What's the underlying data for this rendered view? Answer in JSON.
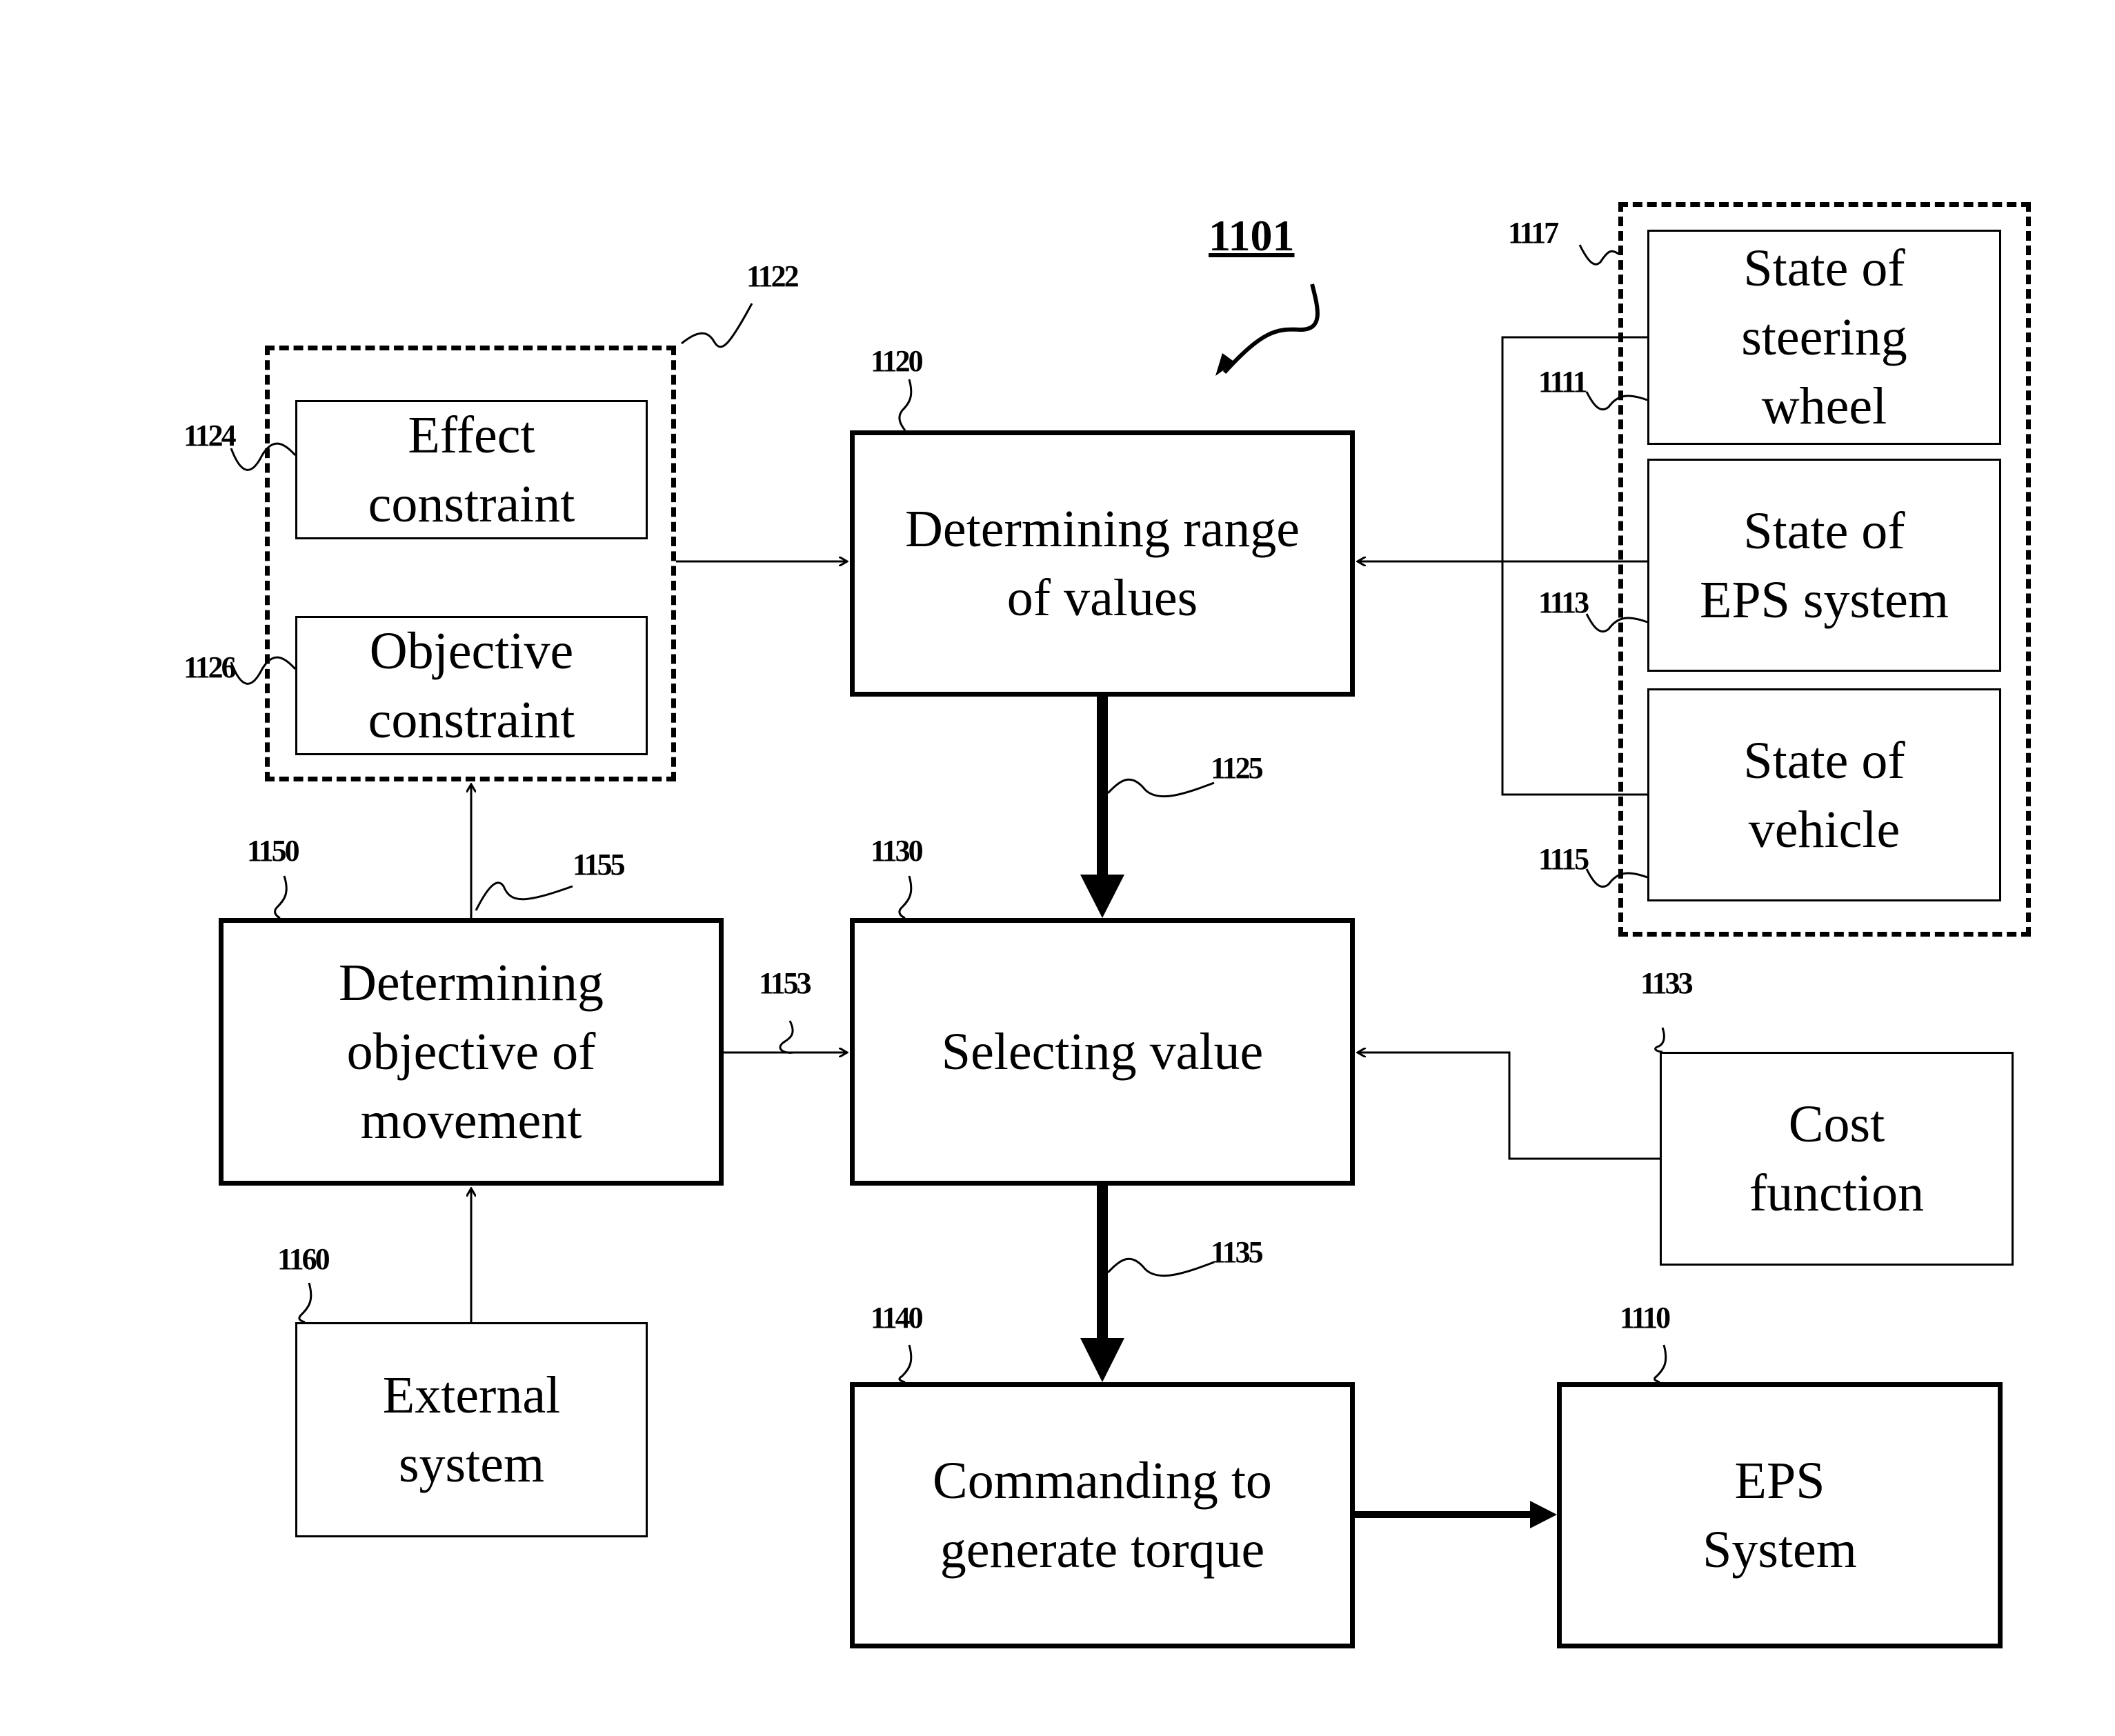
{
  "figure": {
    "ref": "1101"
  },
  "groups": {
    "constraints": {
      "ref": "1122"
    },
    "states": {
      "ref": "1117"
    }
  },
  "blocks": {
    "effect_constraint": {
      "ref": "1124",
      "label": "Effect\nconstraint"
    },
    "objective_constraint": {
      "ref": "1126",
      "label": "Objective\nconstraint"
    },
    "determining_range": {
      "ref": "1120",
      "label": "Determining range\nof values"
    },
    "state_steering": {
      "ref": "1111",
      "label": "State of\nsteering\nwheel"
    },
    "state_eps": {
      "ref": "1113",
      "label": "State of\nEPS system"
    },
    "state_vehicle": {
      "ref": "1115",
      "label": "State of\nvehicle"
    },
    "determining_objective": {
      "ref": "1150",
      "label": "Determining\nobjective of\nmovement"
    },
    "selecting_value": {
      "ref": "1130",
      "label": "Selecting value"
    },
    "cost_function": {
      "ref": "1133",
      "label": "Cost\nfunction"
    },
    "external_system": {
      "ref": "1160",
      "label": "External\nsystem"
    },
    "commanding": {
      "ref": "1140",
      "label": "Commanding to\ngenerate torque"
    },
    "eps_system": {
      "ref": "1110",
      "label": "EPS\nSystem"
    }
  },
  "connections": {
    "range_to_select": {
      "ref": "1125"
    },
    "select_to_command": {
      "ref": "1135"
    },
    "objective_to_select": {
      "ref": "1153"
    },
    "objective_to_constraints": {
      "ref": "1155"
    }
  }
}
